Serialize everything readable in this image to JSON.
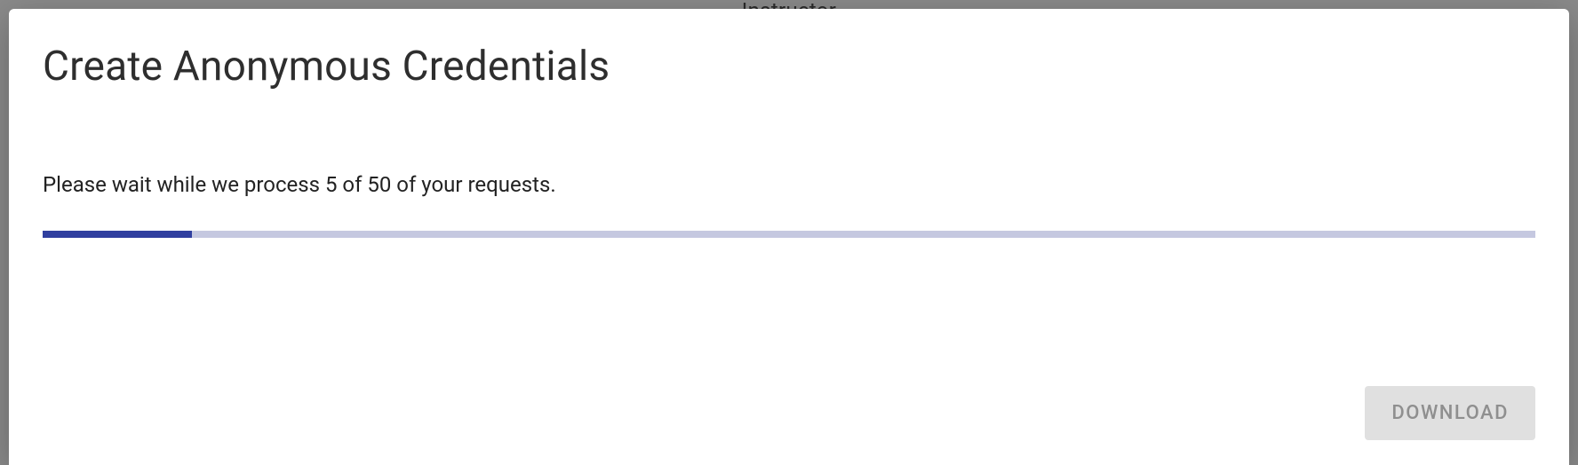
{
  "backdrop": {
    "text": "Instructor"
  },
  "modal": {
    "title": "Create Anonymous Credentials",
    "status_text": "Please wait while we process 5 of 50 of your requests.",
    "progress": {
      "current": 5,
      "total": 50,
      "percent": 10
    },
    "actions": {
      "download_label": "DOWNLOAD"
    }
  },
  "colors": {
    "progress_fill": "#303f9f",
    "progress_track": "#c5c8e0",
    "button_disabled_bg": "#e0e0e0",
    "button_disabled_fg": "#8f8f8f"
  }
}
